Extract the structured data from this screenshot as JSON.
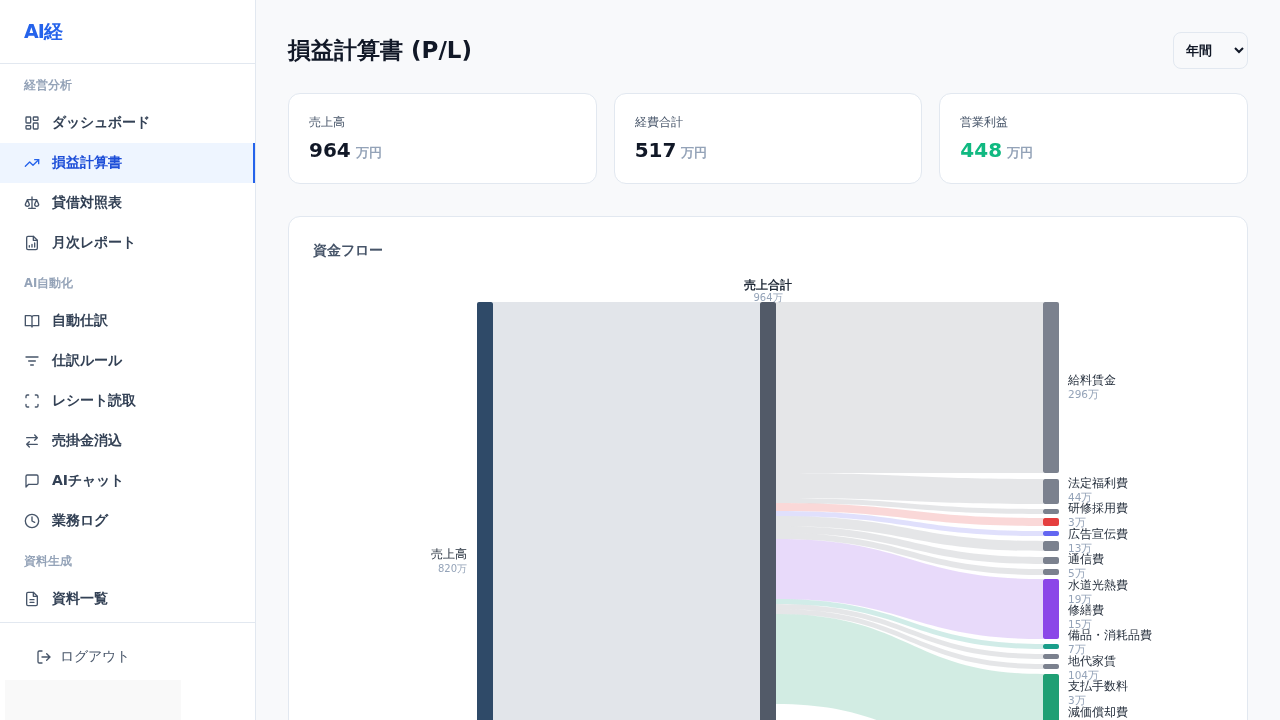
{
  "sidebar": {
    "logo": "AI経",
    "sections": [
      {
        "heading": "経営分析",
        "items": [
          {
            "label": "ダッシュボード",
            "selected": false
          },
          {
            "label": "損益計算書",
            "selected": true
          },
          {
            "label": "貸借対照表",
            "selected": false
          },
          {
            "label": "月次レポート",
            "selected": false
          }
        ]
      },
      {
        "heading": "AI自動化",
        "items": [
          {
            "label": "自動仕訳",
            "selected": false
          },
          {
            "label": "仕訳ルール",
            "selected": false
          },
          {
            "label": "レシート読取",
            "selected": false
          },
          {
            "label": "売掛金消込",
            "selected": false
          },
          {
            "label": "AIチャット",
            "selected": false
          },
          {
            "label": "業務ログ",
            "selected": false
          }
        ]
      },
      {
        "heading": "資料生成",
        "items": [
          {
            "label": "資料一覧",
            "selected": false
          }
        ]
      }
    ],
    "logout": "ログアウト"
  },
  "page": {
    "title": "損益計算書 (P/L)",
    "period": "年間"
  },
  "kpis": [
    {
      "label": "売上高",
      "value": "964",
      "unit": "万円",
      "color": "#111827"
    },
    {
      "label": "経費合計",
      "value": "517",
      "unit": "万円",
      "color": "#111827"
    },
    {
      "label": "営業利益",
      "value": "448",
      "unit": "万円",
      "color": "#10b981"
    }
  ],
  "flow": {
    "title": "資金フロー",
    "source": {
      "label": "売上高",
      "value": "820万",
      "color": "#2f4a68"
    },
    "center": {
      "label": "売上合計",
      "value": "964万",
      "color": "#525a68"
    },
    "outflow_nodes": [
      {
        "color": "#7b818e"
      },
      {
        "color": "#7b818e"
      },
      {
        "color": "#7b818e"
      },
      {
        "color": "#e53e3e"
      },
      {
        "color": "#6366f1"
      },
      {
        "color": "#7b818e"
      },
      {
        "color": "#7b818e"
      },
      {
        "color": "#7b818e"
      },
      {
        "color": "#8b47e8"
      },
      {
        "color": "#1a9e8a"
      },
      {
        "color": "#7b818e"
      },
      {
        "color": "#7b818e"
      },
      {
        "color": "#1f9f74"
      }
    ],
    "outflow_labels": [
      {
        "label": "給料賃金",
        "value": "296万"
      },
      {
        "label": "法定福利費",
        "value": "44万"
      },
      {
        "label": "研修採用費",
        "value": "3万"
      },
      {
        "label": "広告宣伝費",
        "value": "13万"
      },
      {
        "label": "通信費",
        "value": "5万"
      },
      {
        "label": "水道光熱費",
        "value": "19万"
      },
      {
        "label": "修繕費",
        "value": "15万"
      },
      {
        "label": "備品・消耗品費",
        "value": "7万"
      },
      {
        "label": "地代家賃",
        "value": "104万"
      },
      {
        "label": "支払手数料",
        "value": "3万"
      },
      {
        "label": "減価償却費"
      }
    ]
  }
}
